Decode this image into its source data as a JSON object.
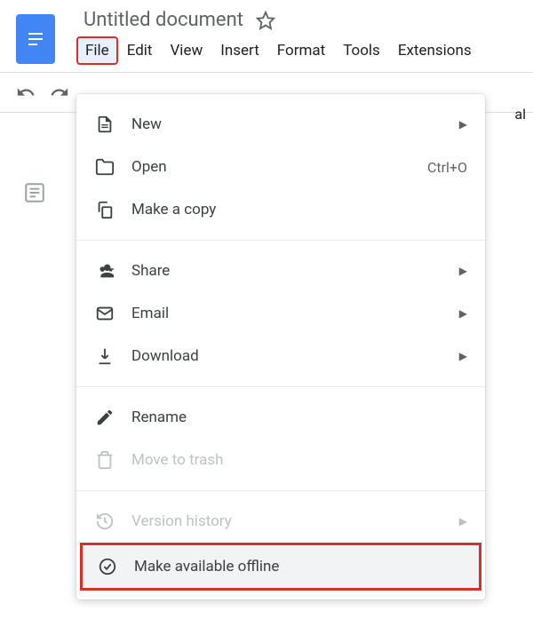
{
  "doc": {
    "title": "Untitled document"
  },
  "menubar": {
    "items": [
      "File",
      "Edit",
      "View",
      "Insert",
      "Format",
      "Tools",
      "Extensions"
    ]
  },
  "toolbar": {
    "right_fragment": "al"
  },
  "dropdown": {
    "items": [
      {
        "label": "New",
        "submenu": true
      },
      {
        "label": "Open",
        "shortcut": "Ctrl+O"
      },
      {
        "label": "Make a copy"
      }
    ],
    "group2": [
      {
        "label": "Share",
        "submenu": true
      },
      {
        "label": "Email",
        "submenu": true
      },
      {
        "label": "Download",
        "submenu": true
      }
    ],
    "group3": [
      {
        "label": "Rename"
      },
      {
        "label": "Move to trash",
        "disabled": true
      }
    ],
    "group4": [
      {
        "label": "Version history",
        "submenu": true,
        "disabled": true
      },
      {
        "label": "Make available offline",
        "highlighted": true
      }
    ]
  }
}
